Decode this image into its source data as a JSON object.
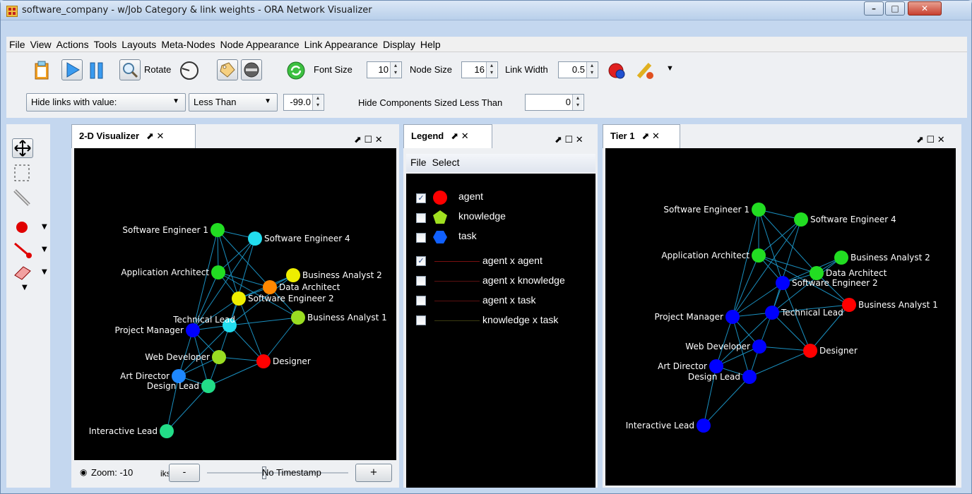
{
  "window": {
    "title": "software_company - w/Job Category & link weights - ORA Network Visualizer"
  },
  "menubar": [
    "File",
    "View",
    "Actions",
    "Tools",
    "Layouts",
    "Meta-Nodes",
    "Node Appearance",
    "Link Appearance",
    "Display",
    "Help"
  ],
  "toolbar": {
    "rotate_label": "Rotate",
    "font_size_label": "Font Size",
    "font_size_value": "10",
    "node_size_label": "Node Size",
    "node_size_value": "16",
    "link_width_label": "Link Width",
    "link_width_value": "0.5",
    "hide_links_select": "Hide links with value:",
    "comparison_select": "Less Than",
    "threshold_value": "-99.0",
    "hide_components_label": "Hide Components Sized Less Than",
    "hide_components_value": "0"
  },
  "panels": {
    "viz1_title": "2-D Visualizer",
    "legend_title": "Legend",
    "viz2_title": "Tier 1"
  },
  "legend": {
    "menu": [
      "File",
      "Select"
    ],
    "items": [
      {
        "label": "agent",
        "checked": true,
        "color": "#ff0000",
        "shape": "circle"
      },
      {
        "label": "knowledge",
        "checked": false,
        "color": "#a0e020",
        "shape": "pentagon"
      },
      {
        "label": "task",
        "checked": false,
        "color": "#1060ff",
        "shape": "hexagon"
      },
      {
        "label": "agent x agent",
        "checked": true,
        "line_color": "#7a1010"
      },
      {
        "label": "agent x knowledge",
        "checked": false,
        "line_color": "#5a1010"
      },
      {
        "label": "agent x task",
        "checked": false,
        "line_color": "#5a1010"
      },
      {
        "label": "knowledge x task",
        "checked": false,
        "line_color": "#3a3a10"
      }
    ]
  },
  "zoom": {
    "label": "Zoom: -10",
    "minus": "-",
    "plus": "+",
    "timestamp": "No Timestamp",
    "partial": "iks"
  },
  "graph_left": {
    "nodes": [
      {
        "id": "se1",
        "label": "Software Engineer 1",
        "color": "#22dd22"
      },
      {
        "id": "se4",
        "label": "Software Engineer 4",
        "color": "#22ddee"
      },
      {
        "id": "aa",
        "label": "Application Architect",
        "color": "#22dd22"
      },
      {
        "id": "ba2",
        "label": "Business Analyst 2",
        "color": "#eeee00"
      },
      {
        "id": "da",
        "label": "Data Architect",
        "color": "#ff8800"
      },
      {
        "id": "se2",
        "label": "Software Engineer 2",
        "color": "#eeee00"
      },
      {
        "id": "ba1",
        "label": "Business Analyst 1",
        "color": "#99dd22"
      },
      {
        "id": "pm",
        "label": "Project Manager",
        "color": "#0000ff"
      },
      {
        "id": "tl",
        "label": "Technical Lead",
        "color": "#22ddee"
      },
      {
        "id": "wd",
        "label": "Web Developer",
        "color": "#99dd22"
      },
      {
        "id": "des",
        "label": "Designer",
        "color": "#ff0000"
      },
      {
        "id": "ad",
        "label": "Art Director",
        "color": "#1e88ff"
      },
      {
        "id": "dl",
        "label": "Design Lead",
        "color": "#22dd88"
      },
      {
        "id": "il",
        "label": "Interactive Lead",
        "color": "#22dd88"
      }
    ]
  },
  "graph_right": {
    "nodes": [
      {
        "id": "se1",
        "label": "Software Engineer 1",
        "color": "#22dd22"
      },
      {
        "id": "se4",
        "label": "Software Engineer 4",
        "color": "#22dd22"
      },
      {
        "id": "aa",
        "label": "Application Architect",
        "color": "#22dd22"
      },
      {
        "id": "ba2",
        "label": "Business Analyst 2",
        "color": "#22dd22"
      },
      {
        "id": "da",
        "label": "Data Architect",
        "color": "#22dd22"
      },
      {
        "id": "se2",
        "label": "Software Engineer 2",
        "color": "#0000ff"
      },
      {
        "id": "ba1",
        "label": "Business Analyst 1",
        "color": "#ff0000"
      },
      {
        "id": "pm",
        "label": "Project Manager",
        "color": "#0000ff"
      },
      {
        "id": "tl",
        "label": "Technical Lead",
        "color": "#0000ff"
      },
      {
        "id": "wd",
        "label": "Web Developer",
        "color": "#0000ff"
      },
      {
        "id": "des",
        "label": "Designer",
        "color": "#ff0000"
      },
      {
        "id": "ad",
        "label": "Art Director",
        "color": "#0000ff"
      },
      {
        "id": "dl",
        "label": "Design Lead",
        "color": "#0000ff"
      },
      {
        "id": "il",
        "label": "Interactive Lead",
        "color": "#0000ff"
      }
    ]
  },
  "link_color": "#1a8fbf"
}
